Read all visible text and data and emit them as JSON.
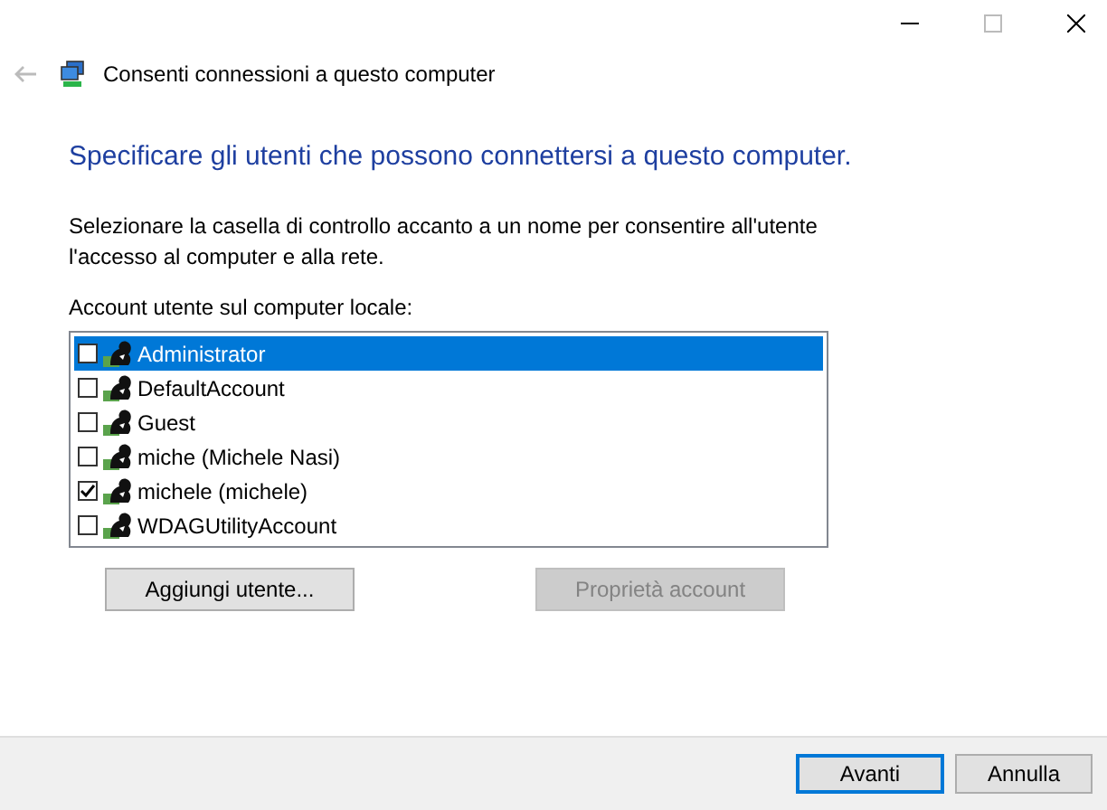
{
  "window": {
    "title": "Consenti connessioni a questo computer",
    "back_disabled": true
  },
  "heading": "Specificare gli utenti che possono connettersi a questo computer.",
  "description": "Selezionare la casella di controllo accanto a un nome per consentire all'utente l'accesso al computer e alla rete.",
  "list_label": "Account utente sul computer locale:",
  "accounts": [
    {
      "name": "Administrator",
      "checked": false,
      "selected": true
    },
    {
      "name": "DefaultAccount",
      "checked": false,
      "selected": false
    },
    {
      "name": "Guest",
      "checked": false,
      "selected": false
    },
    {
      "name": "miche (Michele Nasi)",
      "checked": false,
      "selected": false
    },
    {
      "name": "michele (michele)",
      "checked": true,
      "selected": false
    },
    {
      "name": "WDAGUtilityAccount",
      "checked": false,
      "selected": false
    }
  ],
  "list_buttons": [
    {
      "label": "Aggiungi utente...",
      "disabled": false
    },
    {
      "label": "Proprietà account",
      "disabled": true
    }
  ],
  "footer_buttons": [
    {
      "label": "Avanti",
      "default": true
    },
    {
      "label": "Annulla",
      "default": false
    }
  ]
}
